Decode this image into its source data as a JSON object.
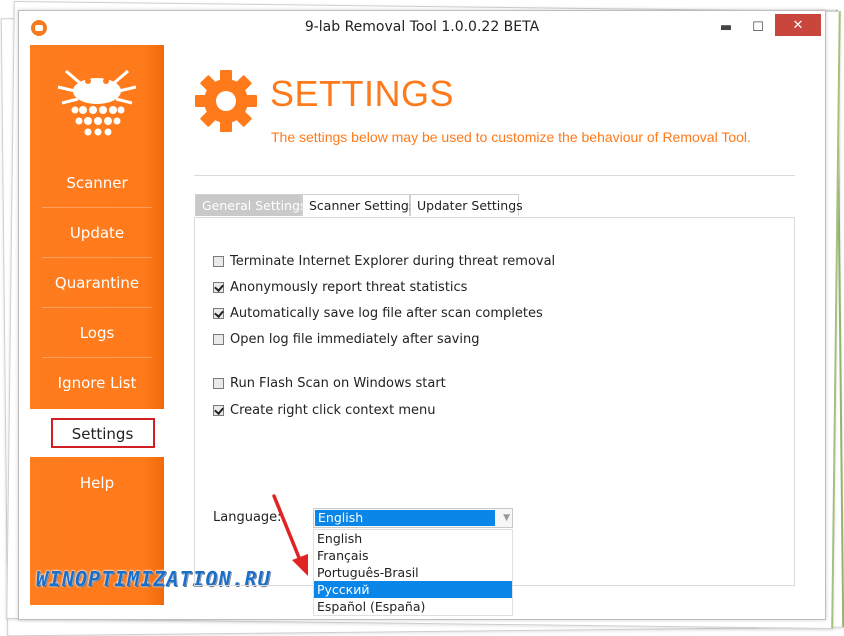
{
  "window": {
    "title": "9-lab Removal Tool 1.0.0.22 BETA",
    "minimize_glyph": "▬",
    "maximize_glyph": "☐",
    "close_glyph": "✕"
  },
  "sidebar": {
    "items": [
      {
        "label": "Scanner"
      },
      {
        "label": "Update"
      },
      {
        "label": "Quarantine"
      },
      {
        "label": "Logs"
      },
      {
        "label": "Ignore List"
      },
      {
        "label": "Settings"
      },
      {
        "label": "Help"
      }
    ],
    "active": "Settings",
    "accent_color": "#ff7a1a",
    "highlight_border_color": "#d31f1f"
  },
  "watermark": "WINOPTIMIZATION.RU",
  "header": {
    "title": "SETTINGS",
    "subtitle": "The settings below may be used to customize the behaviour of Removal Tool.",
    "icon": "gear-icon"
  },
  "tabs": [
    {
      "label": "General Settings"
    },
    {
      "label": "Scanner Settings"
    },
    {
      "label": "Updater Settings"
    }
  ],
  "general": {
    "options": [
      {
        "label": "Terminate Internet Explorer during threat removal",
        "checked": false
      },
      {
        "label": "Anonymously report threat statistics",
        "checked": true
      },
      {
        "label": "Automatically save log file after scan completes",
        "checked": true
      },
      {
        "label": "Open log file immediately after saving",
        "checked": false
      },
      {
        "label": "Run Flash Scan on Windows start",
        "checked": false
      },
      {
        "label": "Create right click context menu",
        "checked": true
      }
    ],
    "language": {
      "label": "Language:",
      "selected": "English",
      "options": [
        "English",
        "Français",
        "Português-Brasil",
        "Русский",
        "Español (España)"
      ],
      "highlighted_option": "Русский"
    }
  }
}
